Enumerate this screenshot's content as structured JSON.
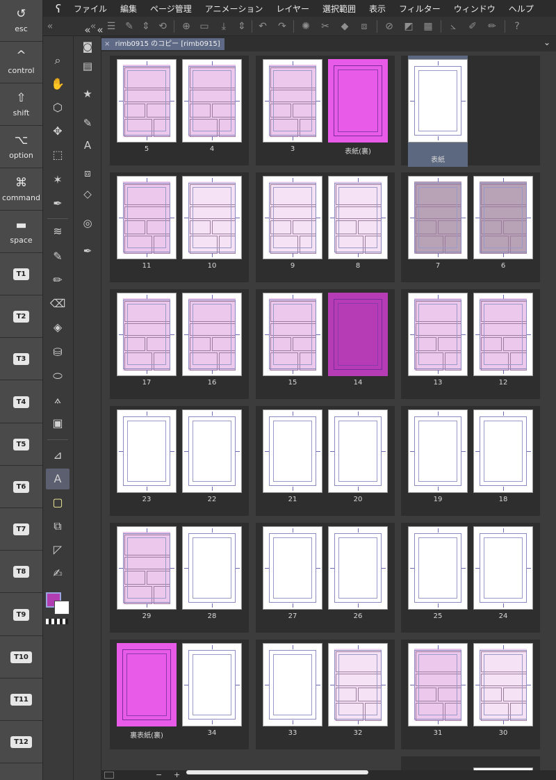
{
  "keys": [
    {
      "name": "esc",
      "glyph": "↺",
      "label": "esc"
    },
    {
      "name": "control",
      "glyph": "^",
      "label": "control"
    },
    {
      "name": "shift",
      "glyph": "⇧",
      "label": "shift"
    },
    {
      "name": "option",
      "glyph": "⌥",
      "label": "option"
    },
    {
      "name": "command",
      "glyph": "⌘",
      "label": "command"
    },
    {
      "name": "space",
      "glyph": "▬",
      "label": "space"
    }
  ],
  "tkeys": [
    "T1",
    "T2",
    "T3",
    "T4",
    "T5",
    "T6",
    "T7",
    "T8",
    "T9",
    "T10",
    "T11",
    "T12"
  ],
  "menu": {
    "logo": "ʕ",
    "items": [
      "ファイル",
      "編集",
      "ページ管理",
      "アニメーション",
      "レイヤー",
      "選択範囲",
      "表示",
      "フィルター",
      "ウィンドウ",
      "ヘルプ"
    ]
  },
  "document": {
    "tab_title": "rimb0915 のコピー [rimb0915]",
    "close_glyph": "×",
    "menu_glyph": "⌄"
  },
  "colors": {
    "main": "#b23db3",
    "sub": "#ffffff",
    "tab_active": "#5e6a86",
    "accent_magenta": "#e85ae8"
  },
  "pages": [
    {
      "label": "5",
      "type": "art"
    },
    {
      "label": "4",
      "type": "art"
    },
    {
      "label": "3",
      "type": "art"
    },
    {
      "label": "表紙(裏)",
      "type": "magenta"
    },
    {
      "label": "表紙",
      "type": "blank",
      "selected": true
    },
    {
      "label": "11",
      "type": "art"
    },
    {
      "label": "10",
      "type": "light"
    },
    {
      "label": "9",
      "type": "light"
    },
    {
      "label": "8",
      "type": "light"
    },
    {
      "label": "7",
      "type": "grey"
    },
    {
      "label": "6",
      "type": "grey"
    },
    {
      "label": "17",
      "type": "art"
    },
    {
      "label": "16",
      "type": "art"
    },
    {
      "label": "15",
      "type": "art"
    },
    {
      "label": "14",
      "type": "magenta-dark"
    },
    {
      "label": "13",
      "type": "art"
    },
    {
      "label": "12",
      "type": "art"
    },
    {
      "label": "23",
      "type": "blank"
    },
    {
      "label": "22",
      "type": "blank"
    },
    {
      "label": "21",
      "type": "blank"
    },
    {
      "label": "20",
      "type": "blank"
    },
    {
      "label": "19",
      "type": "blank"
    },
    {
      "label": "18",
      "type": "blank"
    },
    {
      "label": "29",
      "type": "art"
    },
    {
      "label": "28",
      "type": "blank"
    },
    {
      "label": "27",
      "type": "blank"
    },
    {
      "label": "26",
      "type": "blank"
    },
    {
      "label": "25",
      "type": "blank"
    },
    {
      "label": "24",
      "type": "blank"
    },
    {
      "label": "裏表紙(裏)",
      "type": "magenta"
    },
    {
      "label": "34",
      "type": "blank"
    },
    {
      "label": "33",
      "type": "blank"
    },
    {
      "label": "32",
      "type": "light"
    },
    {
      "label": "31",
      "type": "art"
    },
    {
      "label": "30",
      "type": "light"
    }
  ],
  "statusbar": {
    "minus": "−",
    "plus": "+"
  }
}
